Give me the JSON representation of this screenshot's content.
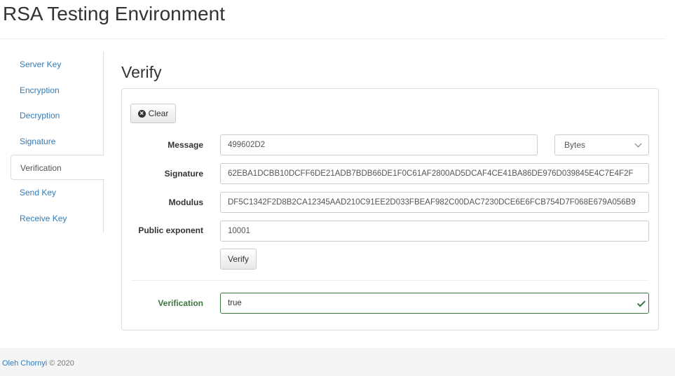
{
  "app": {
    "title": "RSA Testing Environment"
  },
  "sidebar": {
    "items": [
      {
        "label": "Server Key",
        "active": false
      },
      {
        "label": "Encryption",
        "active": false
      },
      {
        "label": "Decryption",
        "active": false
      },
      {
        "label": "Signature",
        "active": false
      },
      {
        "label": "Verification",
        "active": true
      },
      {
        "label": "Send Key",
        "active": false
      },
      {
        "label": "Receive Key",
        "active": false
      }
    ]
  },
  "main": {
    "section_title": "Verify",
    "clear_button": {
      "label": "Clear",
      "icon": "circle-x-icon"
    },
    "form": {
      "message": {
        "label": "Message",
        "value": "499602D2"
      },
      "format_select": {
        "selected": "Bytes"
      },
      "signature": {
        "label": "Signature",
        "value": "62EBA1DCBB10DCFF6DE21ADB7BDB66DE1F0C61AF2800AD5DCAF4CE41BA86DE976D039845E4C7E4F2F"
      },
      "modulus": {
        "label": "Modulus",
        "value": "DF5C1342F2D8B2CA12345AAD210C91EE2D033FBEAF982C00DAC7230DCE6E6FCB754D7F068E679A056B9"
      },
      "public_exponent": {
        "label": "Public exponent",
        "value": "10001"
      },
      "verify_button": {
        "label": "Verify"
      }
    },
    "result": {
      "label": "Verification",
      "value": "true",
      "status_icon": "checkmark-icon",
      "status_color": "#3c763d"
    }
  },
  "footer": {
    "author": "Oleh Chornyi",
    "copyright": "© 2020"
  },
  "colors": {
    "link": "#337ab7",
    "success": "#3c763d",
    "border": "#dddddd"
  }
}
